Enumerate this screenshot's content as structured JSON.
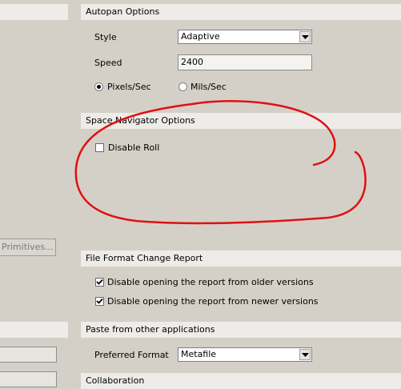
{
  "autopan": {
    "header": "Autopan Options",
    "style_label": "Style",
    "style_value": "Adaptive",
    "speed_label": "Speed",
    "speed_value": "2400",
    "radio_pixels_label": "Pixels/Sec",
    "radio_mils_label": "Mils/Sec",
    "pixels_selected": true
  },
  "space_nav": {
    "header": "Space Navigator Options",
    "disable_roll_label": "Disable Roll",
    "disable_roll_checked": false
  },
  "left": {
    "primitives_button": "Primitives..."
  },
  "file_format": {
    "header": "File Format Change Report",
    "older_label": "Disable opening the report from older versions",
    "older_checked": true,
    "newer_label": "Disable opening the report from newer versions",
    "newer_checked": true
  },
  "paste": {
    "header": "Paste from other applications",
    "format_label": "Preferred Format",
    "format_value": "Metafile"
  },
  "collab": {
    "header": "Collaboration"
  },
  "colors": {
    "background": "#d4d0c8",
    "section_header": "#eeece8",
    "annotation_red": "#e01010"
  }
}
